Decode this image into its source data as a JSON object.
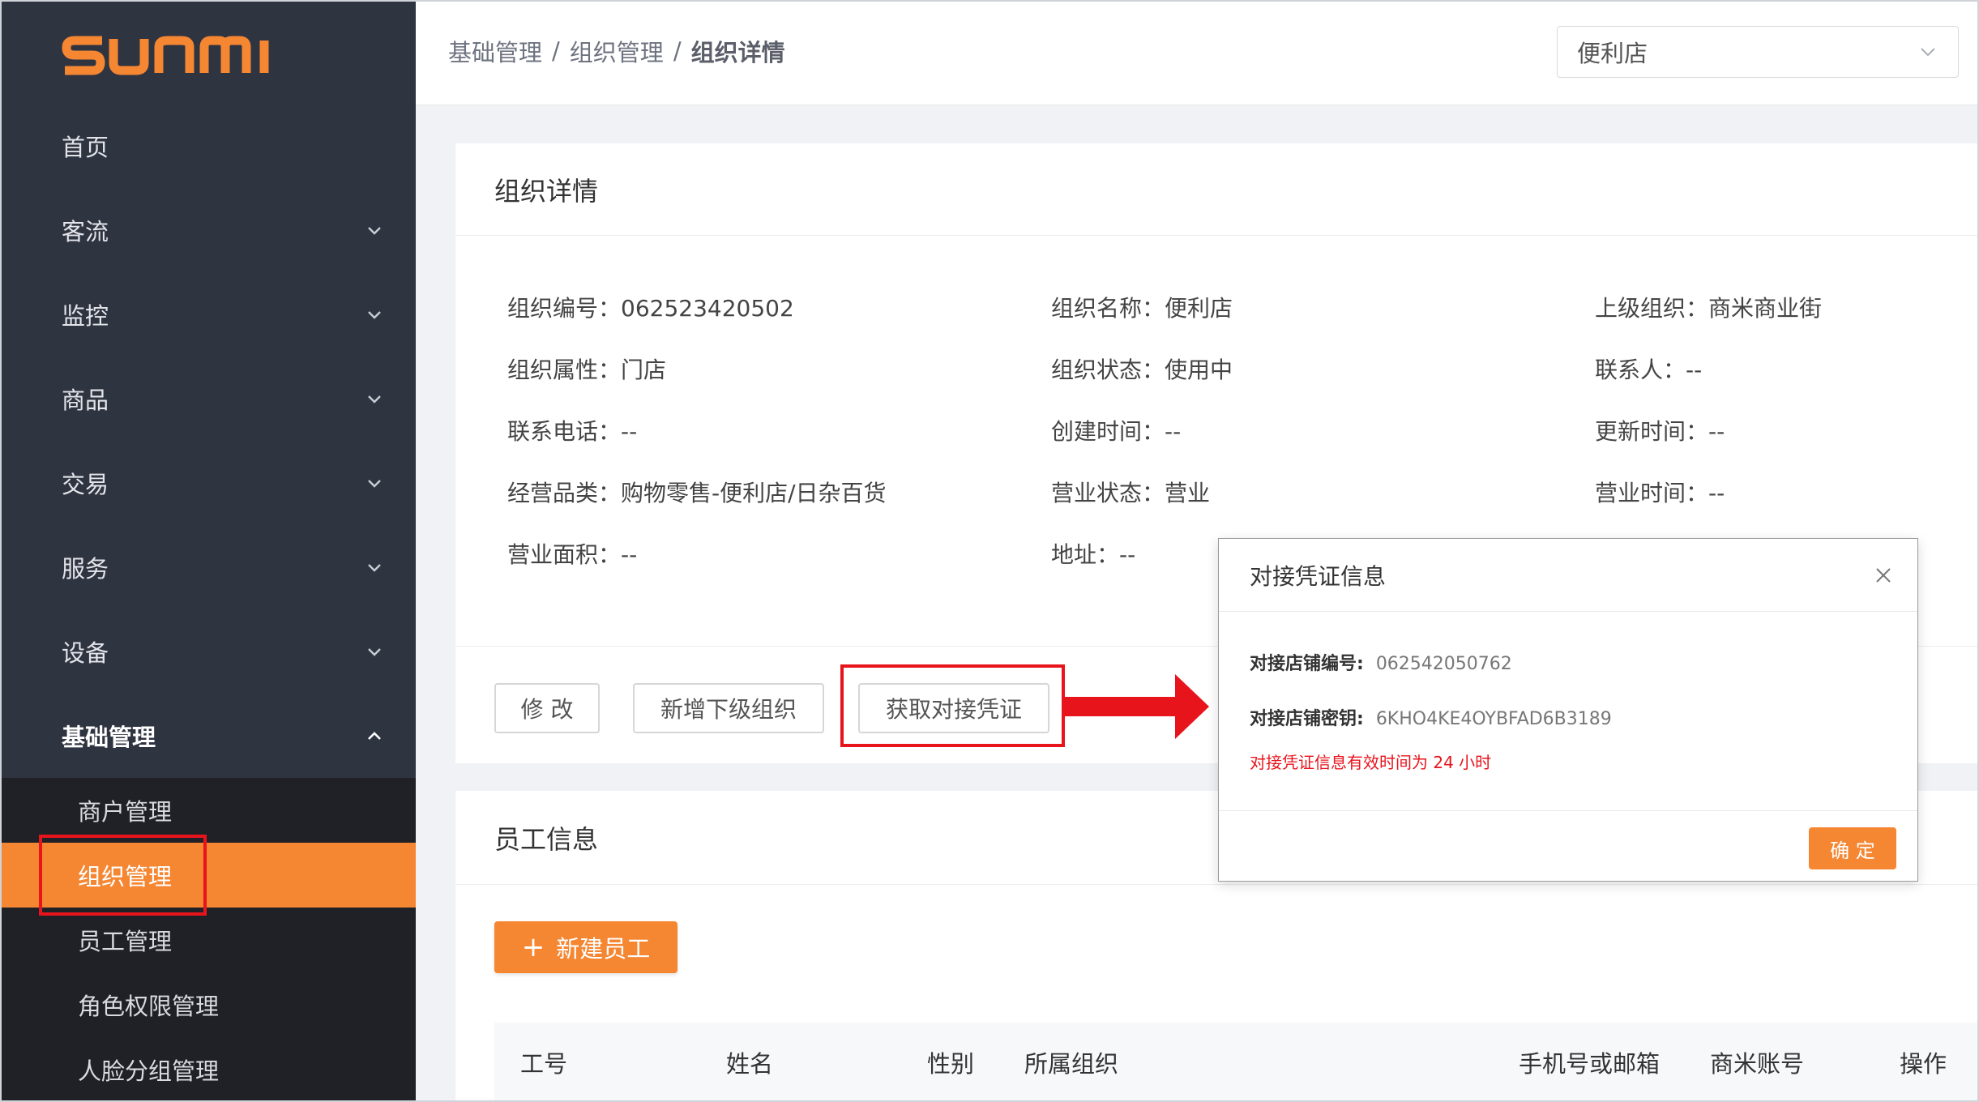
{
  "brand": {
    "logo_text": "SUNMI",
    "accent": "#f58632",
    "highlight": "#e8141c"
  },
  "sidebar": {
    "items": [
      {
        "label": "首页",
        "has_chevron": false
      },
      {
        "label": "客流",
        "has_chevron": true
      },
      {
        "label": "监控",
        "has_chevron": true
      },
      {
        "label": "商品",
        "has_chevron": true
      },
      {
        "label": "交易",
        "has_chevron": true
      },
      {
        "label": "服务",
        "has_chevron": true
      },
      {
        "label": "设备",
        "has_chevron": true
      },
      {
        "label": "基础管理",
        "has_chevron": true,
        "expanded": true
      }
    ],
    "subitems": [
      {
        "label": "商户管理"
      },
      {
        "label": "组织管理",
        "active": true
      },
      {
        "label": "员工管理"
      },
      {
        "label": "角色权限管理"
      },
      {
        "label": "人脸分组管理"
      }
    ]
  },
  "header": {
    "breadcrumb": [
      "基础管理",
      "组织管理",
      "组织详情"
    ],
    "separator": "/",
    "store_select": {
      "value": "便利店",
      "icon": "chevron-down-icon"
    }
  },
  "detail": {
    "title": "组织详情",
    "fields": [
      {
        "label": "组织编号：",
        "value": "062523420502"
      },
      {
        "label": "组织名称：",
        "value": "便利店"
      },
      {
        "label": "上级组织：",
        "value": "商米商业街"
      },
      {
        "label": "组织属性：",
        "value": "门店"
      },
      {
        "label": "组织状态：",
        "value": "使用中"
      },
      {
        "label": "联系人：",
        "value": "--"
      },
      {
        "label": "联系电话：",
        "value": "--"
      },
      {
        "label": "创建时间：",
        "value": "--"
      },
      {
        "label": "更新时间：",
        "value": "--"
      },
      {
        "label": "经营品类：",
        "value": "购物零售-便利店/日杂百货"
      },
      {
        "label": "营业状态：",
        "value": "营业"
      },
      {
        "label": "营业时间：",
        "value": "--"
      },
      {
        "label": "营业面积：",
        "value": "--"
      },
      {
        "label": "地址：",
        "value": "--"
      }
    ],
    "buttons": {
      "edit": "修 改",
      "add_child": "新增下级组织",
      "get_credential": "获取对接凭证"
    }
  },
  "staff": {
    "title": "员工信息",
    "new_button": "新建员工",
    "new_icon": "plus-icon",
    "columns": [
      "工号",
      "姓名",
      "性别",
      "所属组织",
      "手机号或邮箱",
      "商米账号",
      "操作"
    ]
  },
  "modal": {
    "title": "对接凭证信息",
    "close_icon": "close-icon",
    "store_no_label": "对接店铺编号:",
    "store_no_value": "062542050762",
    "store_key_label": "对接店铺密钥:",
    "store_key_value": "6KHO4KE4OYBFAD6B3189",
    "note": "对接凭证信息有效时间为 24 小时",
    "ok": "确 定"
  }
}
